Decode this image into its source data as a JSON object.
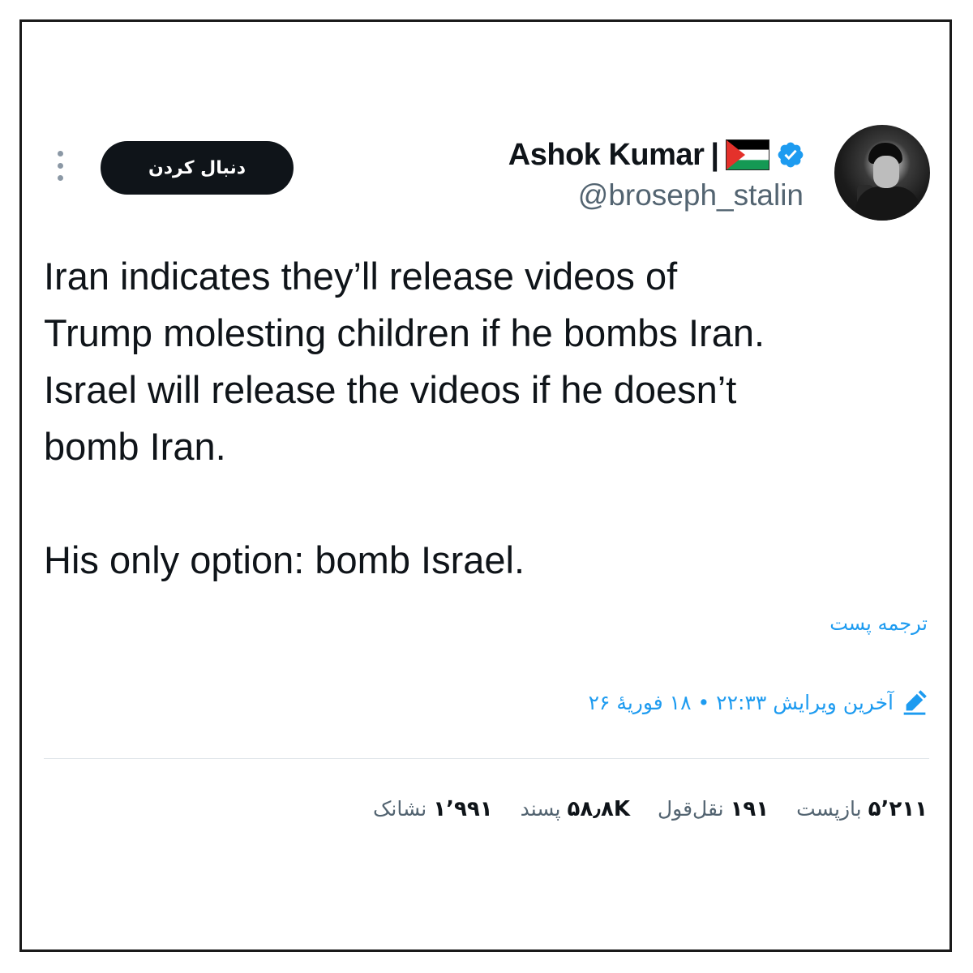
{
  "user": {
    "display_name": "Ashok Kumar",
    "separator": "|",
    "flag_icon": "palestine-flag-icon",
    "verified_icon": "verified-badge-icon",
    "handle": "@broseph_stalin"
  },
  "follow_button": {
    "label": "دنبال کردن"
  },
  "more_menu_icon": "vertical-ellipsis-icon",
  "tweet": {
    "text": "Iran indicates they’ll release videos of\nTrump molesting children if he bombs Iran.\nIsrael will release the videos if he doesn’t\nbomb Iran.\n\nHis only option: bomb Israel."
  },
  "translate_link": "ترجمه پست",
  "edited": {
    "icon": "pencil-icon",
    "text": "آخرین ویرایش ۲۲:۳۳ • ۱۸ فوریهٔ ۲۶"
  },
  "stats": [
    {
      "value": "۵٬۲۱۱",
      "label": "بازپست"
    },
    {
      "value": "۱۹۱",
      "label": "نقل‌قول"
    },
    {
      "value": "۵۸٫۸K",
      "label": "پسند"
    },
    {
      "value": "۱٬۹۹۱",
      "label": "نشانک"
    }
  ],
  "colors": {
    "text": "#0f1419",
    "secondary": "#536471",
    "link": "#1d9bf0",
    "button_bg": "#0f1419"
  }
}
